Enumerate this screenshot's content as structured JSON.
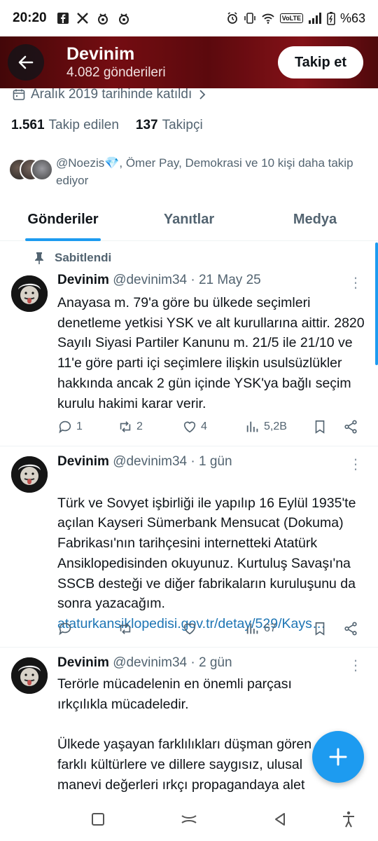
{
  "status_bar": {
    "time": "20:20",
    "battery": "%63",
    "network": "VoLTE",
    "left_icons": [
      "facebook-icon",
      "x-icon",
      "app-icon",
      "app-icon"
    ],
    "right_icons": [
      "alarm-icon",
      "vibrate-icon",
      "wifi-icon",
      "signal-icon",
      "battery-icon"
    ]
  },
  "header": {
    "name": "Devinim",
    "post_count": "4.082 gönderileri",
    "follow_button": "Takip et"
  },
  "profile": {
    "joined": "Aralık 2019 tarihinde katıldı",
    "following_count": "1.561",
    "following_label": "Takip edilen",
    "followers_count": "137",
    "followers_label": "Takipçi",
    "followed_by": "@Noezis💎, Ömer Pay, Demokrasi ve 10 kişi daha takip ediyor"
  },
  "tabs": [
    {
      "label": "Gönderiler",
      "active": true
    },
    {
      "label": "Yanıtlar",
      "active": false
    },
    {
      "label": "Medya",
      "active": false
    }
  ],
  "tweets": [
    {
      "pinned_label": "Sabitlendi",
      "name": "Devinim",
      "meta": "@devinim34 · 21 May 25",
      "text": "Anayasa m. 79'a göre bu ülkede seçimleri denetleme yetkisi YSK ve alt kurullarına aittir. 2820 Sayılı Siyasi Partiler Kanunu m. 21/5 ile 21/10 ve 11'e göre parti içi seçimlere ilişkin usulsüzlükler hakkında ancak 2 gün içinde YSK'ya bağlı seçim kurulu hakimi karar verir.",
      "link": "",
      "replies": "1",
      "reposts": "2",
      "likes": "4",
      "views": "5,2B"
    },
    {
      "pinned_label": "",
      "name": "Devinim",
      "meta": "@devinim34 · 1 gün",
      "text": "Türk ve Sovyet işbirliği ile yapılıp 16 Eylül 1935'te açılan Kayseri Sümerbank Mensucat (Dokuma) Fabrikası'nın tarihçesini internetteki Atatürk Ansiklopedisinden okuyunuz. Kurtuluş Savaşı'na SSCB desteği ve diğer fabrikaların kuruluşunu da sonra yazacağım.",
      "link": "ataturkansiklopedisi.gov.tr/detay/529/Kays…",
      "replies": "",
      "reposts": "",
      "likes": "",
      "views": "67"
    },
    {
      "pinned_label": "",
      "name": "Devinim",
      "meta": "@devinim34 · 2 gün",
      "text": "Terörle mücadelenin en önemli parçası ırkçılıkla mücadeledir.\n\nÜlkede yaşayan farklılıkları düşman gören farklı kültürlere ve dillere saygısız, ulusal manevi değerleri ırkçı propagandaya alet",
      "link": "",
      "replies": "",
      "reposts": "",
      "likes": "",
      "views": ""
    }
  ],
  "colors": {
    "accent": "#1d9bf0",
    "text": "#0f1419",
    "secondary": "#536471",
    "header_bg": "#8a1015"
  }
}
